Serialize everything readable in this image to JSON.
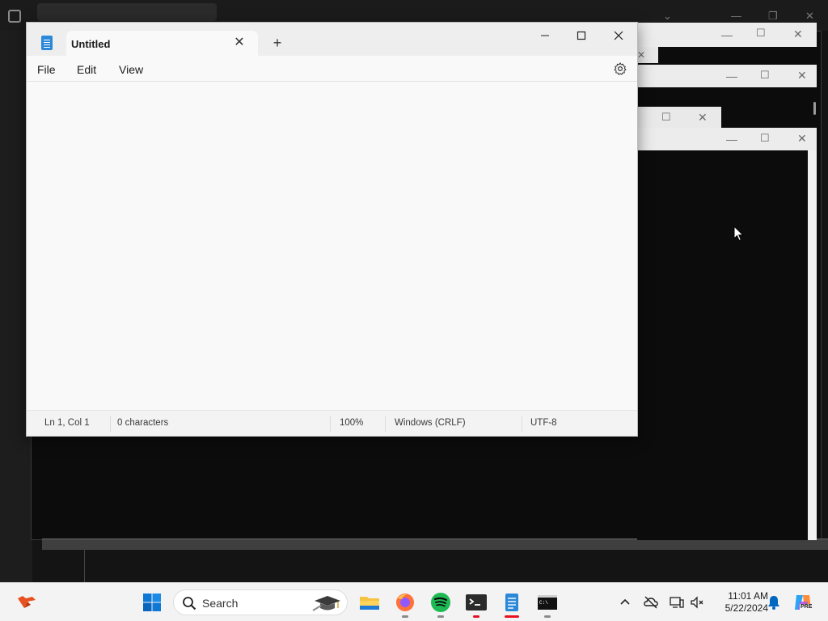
{
  "notepad": {
    "tab_title": "Untitled",
    "tab_close_symbol": "✕",
    "new_tab_symbol": "+",
    "menu": {
      "file": "File",
      "edit": "Edit",
      "view": "View"
    },
    "editor_text": "",
    "status": {
      "position": "Ln 1, Col 1",
      "characters": "0 characters",
      "zoom": "100%",
      "line_ending": "Windows (CRLF)",
      "encoding": "UTF-8"
    }
  },
  "taskbar": {
    "search_label": "Search",
    "time": "11:01 AM",
    "date": "5/22/2024",
    "copilot_badge": "PRE",
    "apps": [
      "file-explorer",
      "firefox",
      "spotify",
      "terminal",
      "notepad",
      "command-prompt"
    ]
  },
  "colors": {
    "accent": "#0067c0",
    "terminal_bg": "#0c0c0c",
    "spotify_green": "#1db954",
    "folder_yellow": "#f5c242",
    "firefox_orange": "#ff7139",
    "active_indicator": "#e81123"
  },
  "icons": [
    "notepad-app-icon",
    "close-icon",
    "plus-icon",
    "minimize-icon",
    "maximize-icon",
    "gear-icon",
    "windows-start-icon",
    "search-icon",
    "chevron-up-icon",
    "onedrive-offline-icon",
    "network-icon",
    "volume-muted-icon",
    "bell-icon",
    "copilot-icon",
    "mouse-pointer-icon"
  ]
}
